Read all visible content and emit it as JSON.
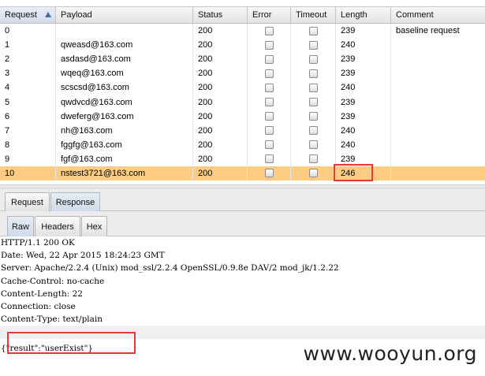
{
  "table": {
    "columns": [
      {
        "label": "Request",
        "sorted": true
      },
      {
        "label": "Payload"
      },
      {
        "label": "Status"
      },
      {
        "label": "Error"
      },
      {
        "label": "Timeout"
      },
      {
        "label": "Length"
      },
      {
        "label": "Comment"
      }
    ],
    "rows": [
      {
        "request": "0",
        "payload": "",
        "status": "200",
        "length": "239",
        "comment": "baseline request"
      },
      {
        "request": "1",
        "payload": "qweasd@163.com",
        "status": "200",
        "length": "240",
        "comment": ""
      },
      {
        "request": "2",
        "payload": "asdasd@163.com",
        "status": "200",
        "length": "239",
        "comment": ""
      },
      {
        "request": "3",
        "payload": "wqeq@163.com",
        "status": "200",
        "length": "239",
        "comment": ""
      },
      {
        "request": "4",
        "payload": "scscsd@163.com",
        "status": "200",
        "length": "240",
        "comment": ""
      },
      {
        "request": "5",
        "payload": "qwdvcd@163.com",
        "status": "200",
        "length": "239",
        "comment": ""
      },
      {
        "request": "6",
        "payload": "dweferg@163.com",
        "status": "200",
        "length": "239",
        "comment": ""
      },
      {
        "request": "7",
        "payload": "nh@163.com",
        "status": "200",
        "length": "240",
        "comment": ""
      },
      {
        "request": "8",
        "payload": "fggfg@163.com",
        "status": "200",
        "length": "240",
        "comment": ""
      },
      {
        "request": "9",
        "payload": "fgf@163.com",
        "status": "200",
        "length": "239",
        "comment": ""
      },
      {
        "request": "10",
        "payload": "nstest3721@163.com",
        "status": "200",
        "length": "246",
        "comment": "",
        "selected": true
      }
    ]
  },
  "tabs_top": [
    {
      "label": "Request"
    },
    {
      "label": "Response",
      "active": true
    }
  ],
  "tabs_view": [
    {
      "label": "Raw",
      "active": true
    },
    {
      "label": "Headers"
    },
    {
      "label": "Hex"
    }
  ],
  "response": {
    "lines": [
      "HTTP/1.1 200 OK",
      "Date: Wed, 22 Apr 2015 18:24:23 GMT",
      "Server: Apache/2.2.4 (Unix) mod_ssl/2.2.4 OpenSSL/0.9.8e DAV/2 mod_jk/1.2.22",
      "Cache-Control: no-cache",
      "Content-Length: 22",
      "Connection: close",
      "Content-Type: text/plain",
      "",
      "{\"result\":\"userExist\"}"
    ]
  },
  "watermark": "www.wooyun.org",
  "colors": {
    "selected_row": "#fdcb82",
    "highlight": "#e53935",
    "active_tab": "#cfdbe9"
  }
}
